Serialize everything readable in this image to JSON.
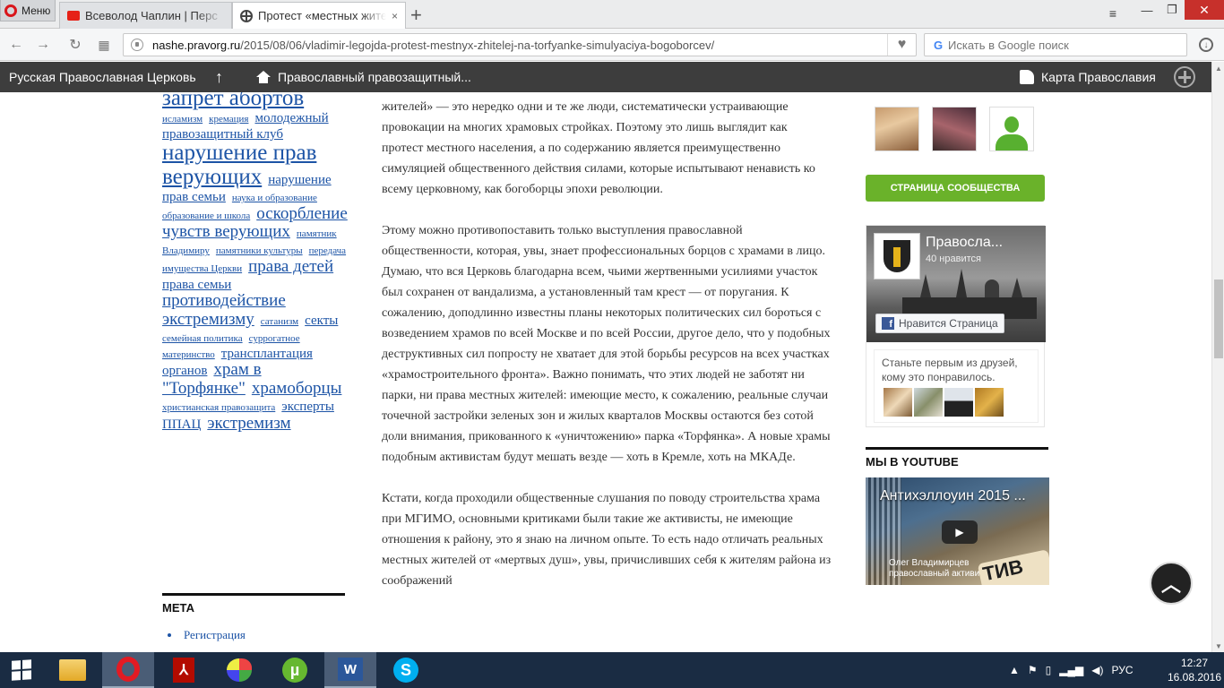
{
  "browser": {
    "menu_label": "Меню",
    "tabs": [
      {
        "title": "Всеволод Чаплин | Перс",
        "favicon": "youtube-icon"
      },
      {
        "title": "Протест «местных жителе",
        "favicon": "cross-icon",
        "active": true
      }
    ],
    "close_tab_glyph": "×",
    "new_tab_glyph": "+",
    "address": {
      "host": "nashe.pravorg.ru",
      "path": "/2015/08/06/vladimir-legojda-protest-mestnyx-zhitelej-na-torfyanke-simulyaciya-bogoborcev/"
    },
    "search_placeholder": "Искать в Google поиск"
  },
  "sitebar": {
    "rpc_link": "Русская Православная Церковь",
    "home_link": "Православный правозащитный...",
    "map_link": "Карта Православия"
  },
  "tagcloud": {
    "tags": [
      {
        "text": "запрет абортов",
        "size": "xl"
      },
      {
        "text": "исламизм",
        "size": "s"
      },
      {
        "text": "кремация",
        "size": "s"
      },
      {
        "text": "молодежный правозащитный клуб",
        "size": "m"
      },
      {
        "text": "нарушение прав верующих",
        "size": "xl"
      },
      {
        "text": "нарушение прав семьи",
        "size": "m"
      },
      {
        "text": "наука и образование",
        "size": "s"
      },
      {
        "text": "образование и школа",
        "size": "s"
      },
      {
        "text": "оскорбление чувств верующих",
        "size": "l"
      },
      {
        "text": "памятник Владимиру",
        "size": "s"
      },
      {
        "text": "памятники культуры",
        "size": "s"
      },
      {
        "text": "передача имущества Церкви",
        "size": "s"
      },
      {
        "text": "права детей",
        "size": "l"
      },
      {
        "text": "права семьи",
        "size": "m"
      },
      {
        "text": "противодействие экстремизму",
        "size": "l"
      },
      {
        "text": "сатанизм",
        "size": "s"
      },
      {
        "text": "секты",
        "size": "m"
      },
      {
        "text": "семейная политика",
        "size": "s"
      },
      {
        "text": "суррогатное материнство",
        "size": "s"
      },
      {
        "text": "трансплантация органов",
        "size": "m"
      },
      {
        "text": "храм в \"Торфянке\"",
        "size": "l"
      },
      {
        "text": "храмоборцы",
        "size": "l"
      },
      {
        "text": "христианская правозащита",
        "size": "s"
      },
      {
        "text": "эксперты ППАЦ",
        "size": "m"
      },
      {
        "text": "экстремизм",
        "size": "l"
      }
    ]
  },
  "meta": {
    "title": "МЕТА",
    "items": [
      "Регистрация"
    ]
  },
  "article": {
    "paragraphs": [
      "жителей» — это нередко одни и те же люди, систематически устраивающие провокации на многих храмовых стройках. Поэтому это лишь выглядит как протест местного населения, а по содержанию является преимущественно симуляцией общественного действия силами, которые испытывают ненависть ко всему церковному, как богоборцы эпохи революции.",
      "Этому можно противопоставить только выступления православной общественности, которая, увы, знает профессиональных борцов с храмами в лицо. Думаю, что вся Церковь благодарна всем, чьими жертвенными усилиями участок был сохранен от вандализма, а установленный там крест — от поругания. К сожалению, доподлинно известны планы некоторых политических сил бороться с возведением храмов по всей Москве и по всей России, другое дело, что у подобных деструктивных сил попросту не хватает для этой борьбы ресурсов на всех участках «храмостроительного фронта». Важно понимать, что этих людей не заботят ни парки, ни права местных жителей: имеющие место, к сожалению, реальные случаи точечной застройки зеленых зон и жилых кварталов Москвы остаются без сотой доли внимания, прикованного к «уничтожению» парка «Торфянка». А новые храмы подобным активистам будут мешать везде — хоть в Кремле, хоть на МКАДе.",
      "Кстати, когда проходили общественные слушания по поводу строительства храма при МГИМО, основными критиками были такие же активисты, не имеющие отношения к району, это я знаю на личном опыте. То есть надо отличать реальных местных жителей от «мертвых душ», увы, причисливших себя к жителям района из соображений"
    ]
  },
  "sidebar_right": {
    "community_button": "СТРАНИЦА СООБЩЕСТВА",
    "fb": {
      "page_name": "Правосла...",
      "likes": "40 нравится",
      "like_button": "Нравится Страница",
      "friends_text": "Станьте первым из друзей, кому это понравилось."
    },
    "youtube": {
      "title": "МЫ В YOUTUBE",
      "video_title": "Антихэллоуин 2015 ...",
      "caption_name": "Олег Владимирцев",
      "caption_role": "православный активист",
      "sign_text": "ТИВ"
    }
  },
  "back_to_top_glyph": "︿",
  "taskbar": {
    "lang": "РУС",
    "time": "12:27",
    "date": "16.08.2016",
    "apps": [
      "file-explorer-icon",
      "opera-icon",
      "acrobat-icon",
      "paint-icon",
      "utorrent-icon",
      "word-icon",
      "skype-icon"
    ]
  }
}
